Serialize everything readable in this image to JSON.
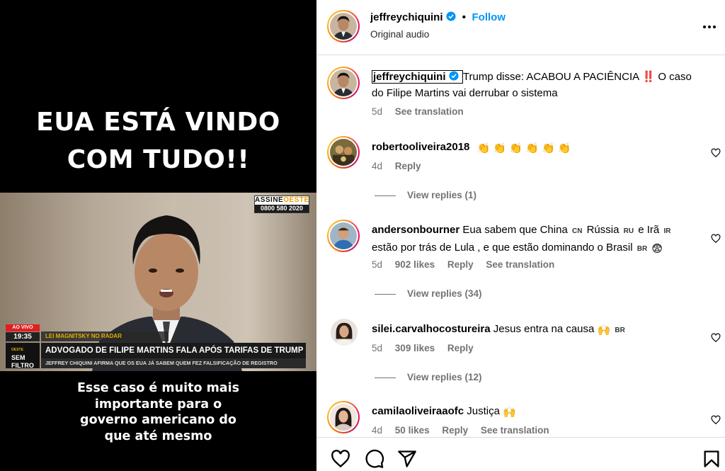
{
  "video": {
    "headline_line1": "EUA ESTÁ VINDO",
    "headline_line2": "COM TUDO!!",
    "broadcast": {
      "assine_left": "ASSINE",
      "assine_right": "OESTE",
      "phone": "0800 580 2020",
      "live": "AO VIVO",
      "time": "19:35",
      "kicker": "LEI MAGNITSKY NO RADAR",
      "logo_small": "OESTE",
      "logo_line1": "SEM",
      "logo_line2": "FILTRO",
      "title": "ADVOGADO DE FILIPE MARTINS FALA APÓS TARIFAS DE TRUMP",
      "subtitle": "JEFFREY CHIQUINI AFIRMA QUE OS EUA JÁ SABEM QUEM FEZ FALSIFICAÇÃO DE REGISTRO"
    },
    "caption_lines": [
      "Esse caso é muito mais",
      "importante para o",
      "governo americano do",
      "que até mesmo"
    ]
  },
  "header": {
    "username": "jeffreychiquini",
    "separator": "•",
    "follow_label": "Follow",
    "audio": "Original audio"
  },
  "caption_post": {
    "username": "jeffreychiquini",
    "text_line1": "Trump disse: ACABOU A PACIÊNCIA",
    "text_bang": "‼️",
    "text_line1b": " O caso",
    "text_line2": "do Filipe Martins vai derrubar o sistema",
    "age": "5d",
    "see_translation": "See translation"
  },
  "comments": [
    {
      "username": "robertooliveira2018",
      "text": "",
      "emoji": "👏 👏 👏 👏 👏 👏",
      "age": "4d",
      "likes": "",
      "reply": "Reply",
      "see_translation": "",
      "view_replies": "View replies (1)"
    },
    {
      "username": "andersonbourner",
      "text_a": "Eua sabem que China",
      "flag_a": "CN",
      "text_b": "Rússia",
      "flag_b": "RU",
      "text_c": "e Irã",
      "flag_c": "IR",
      "text_d": "estão por trás de Lula , e que estão dominando o Brasil",
      "flag_d": "BR",
      "emoji": "😨",
      "age": "5d",
      "likes": "902 likes",
      "reply": "Reply",
      "see_translation": "See translation",
      "view_replies": "View replies (34)"
    },
    {
      "username": "silei.carvalhocostureira",
      "text": "Jesus entra na causa",
      "emoji": "🙌",
      "flag": "BR",
      "age": "5d",
      "likes": "309 likes",
      "reply": "Reply",
      "view_replies": "View replies (12)"
    },
    {
      "username": "camilaoliveiraaofc",
      "text": "Justiça",
      "emoji": "🙌",
      "age": "4d",
      "likes": "50 likes",
      "reply": "Reply",
      "see_translation": "See translation"
    }
  ],
  "colors": {
    "accent": "#0095f6",
    "muted": "#737373",
    "border": "#dbdbdb",
    "verified": "#0095f6"
  },
  "icons": [
    "more-icon",
    "verified-icon",
    "heart-icon",
    "comment-icon",
    "share-icon",
    "bookmark-icon"
  ]
}
